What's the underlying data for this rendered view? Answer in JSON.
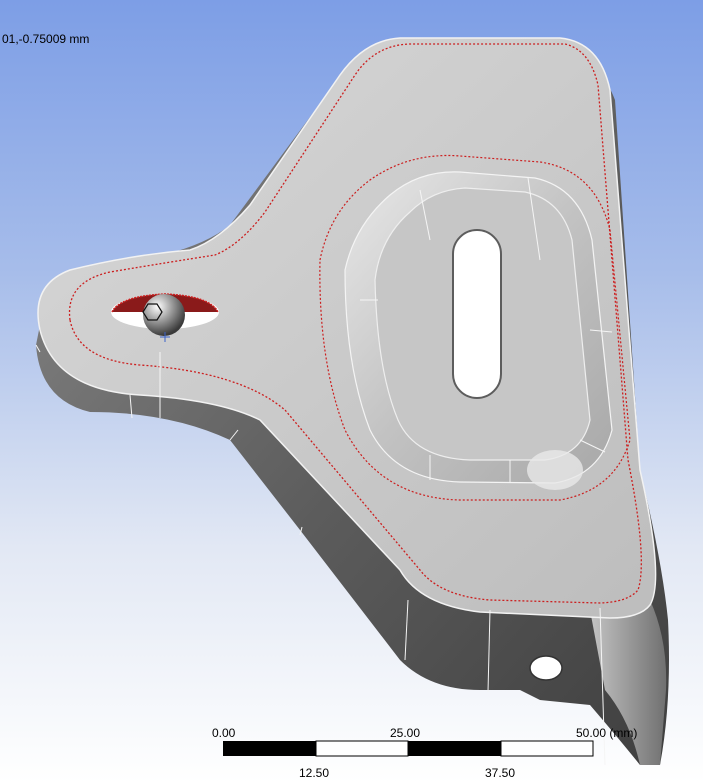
{
  "viewport": {
    "coordinate_readout": "01,-0.75009 mm"
  },
  "scale_bar": {
    "labels_top": [
      "0.00",
      "25.00",
      "50.00 (mm)"
    ],
    "labels_bottom": [
      "12.50",
      "37.50"
    ]
  },
  "colors": {
    "background_top": "#7d9ee6",
    "background_bottom": "#ffffff",
    "part_face": "#c9c9c9",
    "part_wall_dark": "#5a5a5a",
    "selection_edge": "#cc1f1f",
    "hole_fill": "#ffffff"
  },
  "icons": {
    "triad": "axis-triad-icon",
    "cursor": "crosshair-icon"
  }
}
